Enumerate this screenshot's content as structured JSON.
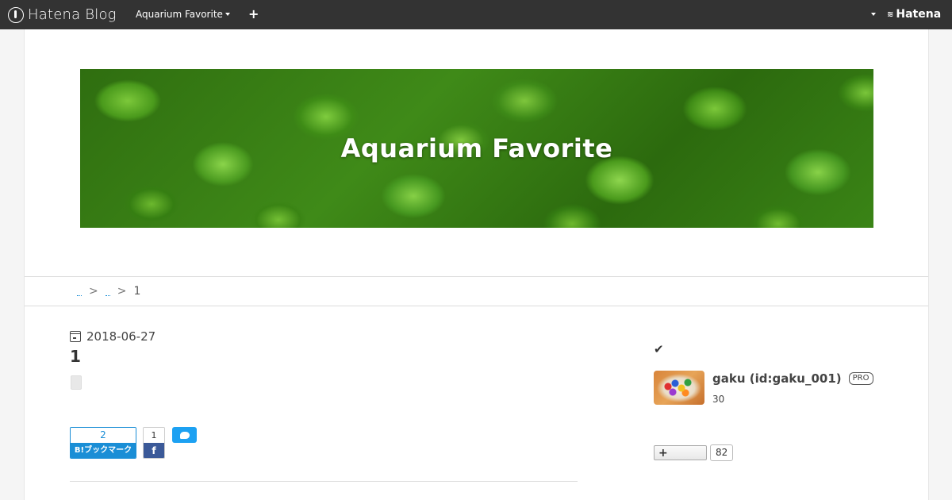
{
  "header": {
    "logo_text": "Hatena Blog",
    "blog_name": "Aquarium Favorite",
    "add_label": "+",
    "hatena_label": "Hatena"
  },
  "banner": {
    "title": "Aquarium Favorite"
  },
  "breadcrumb": {
    "separator_1": ">",
    "separator_2": ">",
    "current": "1"
  },
  "entry": {
    "date": "2018-06-27",
    "title": "1"
  },
  "share": {
    "hatebu_count": "2",
    "hatebu_label": "B!ブックマーク",
    "facebook_count": "1",
    "facebook_icon": "f"
  },
  "sidebar": {
    "check_icon": "✔",
    "user_name": "gaku (id:gaku_001)",
    "pro_badge": "PRO",
    "count": "30",
    "follow_label": "+",
    "follow_count": "82"
  },
  "colors": {
    "header_bg": "#333333",
    "hatebu_blue": "#1a8ed6",
    "facebook_blue": "#3b5998",
    "twitter_blue": "#1da1f2"
  }
}
